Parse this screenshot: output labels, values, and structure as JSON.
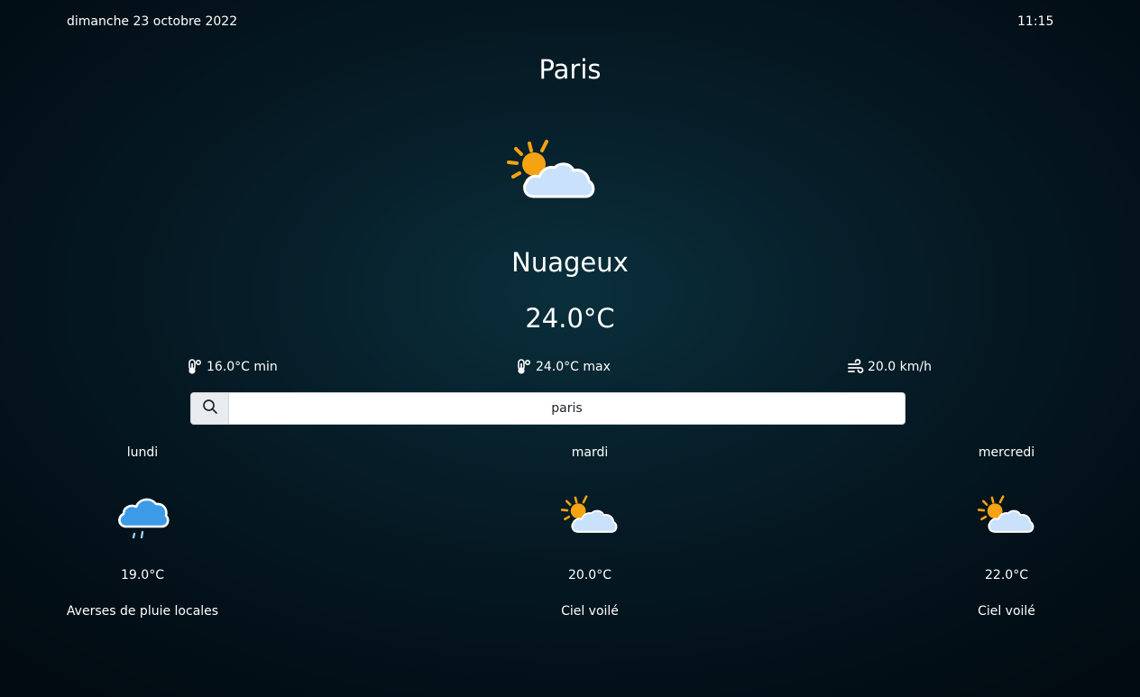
{
  "header": {
    "date": "dimanche 23 octobre 2022",
    "time": "11:15"
  },
  "current": {
    "city": "Paris",
    "icon": "partly-cloudy-icon",
    "condition": "Nuageux",
    "temperature": "24.0°C",
    "min": "16.0°C min",
    "max": "24.0°C max",
    "wind": "20.0 km/h"
  },
  "search": {
    "value": "paris",
    "icon": "search-icon"
  },
  "forecast": [
    {
      "day": "lundi",
      "icon": "rain-shower-icon",
      "temperature": "19.0°C",
      "description": "Averses de pluie locales"
    },
    {
      "day": "mardi",
      "icon": "partly-cloudy-icon",
      "temperature": "20.0°C",
      "description": "Ciel voilé"
    },
    {
      "day": "mercredi",
      "icon": "partly-cloudy-icon",
      "temperature": "22.0°C",
      "description": "Ciel voilé"
    }
  ],
  "colors": {
    "sun": "#F5A312",
    "cloud_light": "#C9E1FA",
    "cloud_rain": "#3D9AE6",
    "search_bg": "#FFFFFF",
    "search_addon": "#E9ECEF"
  }
}
